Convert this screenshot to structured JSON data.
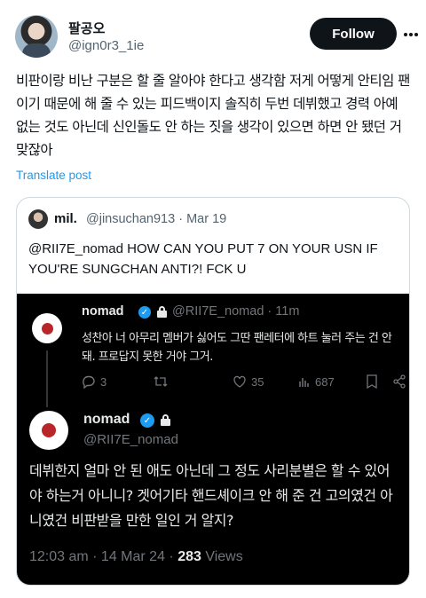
{
  "tweet": {
    "display_name": "팔공오",
    "handle": "@ign0r3_1ie",
    "follow_label": "Follow",
    "text": "비판이랑 비난 구분은 할 줄 알아야 한다고 생각함 저게 어떻게 안티임 팬이기 때문에 해 줄 수 있는 피드백이지 솔직히 두번 데뷔했고 경력 아예 없는 것도 아닌데 신인돌도 안 하는 짓을 생각이 있으면 하면 안 됐던 거 맞잖아",
    "translate_label": "Translate post"
  },
  "quote": {
    "name": "mil.",
    "handle": "@jinsuchan913",
    "date": "Mar 19",
    "text": "@RII7E_nomad HOW CAN YOU PUT 7 ON YOUR USN IF YOU'RE SUNGCHAN ANTI?! FCK U"
  },
  "embedded": {
    "reply": {
      "name": "nomad",
      "handle": "@RII7E_nomad",
      "time": "11m",
      "text": "성찬아 너 아무리 멤버가 싫어도 그딴 팬레터에 하트 눌러 주는 건 안 돼. 프로답지 못한 거야 그거.",
      "replies": "3",
      "likes": "35",
      "views": "687"
    },
    "main": {
      "name": "nomad",
      "handle": "@RII7E_nomad",
      "text": "데뷔한지 얼마 안 된 애도 아닌데 그 정도 사리분별은 할 수 있어야 하는거 아니니? 겟어기타 핸드셰이크 안 해 준 건 고의였건 아니였건 비판받을 만한 일인 거 알지?",
      "timestamp": "12:03 am · 14 Mar 24 · ",
      "views_count": "283",
      "views_label": " Views"
    }
  },
  "colors": {
    "accent": "#1d9bf0",
    "text": "#0f1419",
    "muted": "#536471",
    "dark_bg": "#000000",
    "dark_text": "#e7e9ea",
    "dark_muted": "#71767b"
  }
}
